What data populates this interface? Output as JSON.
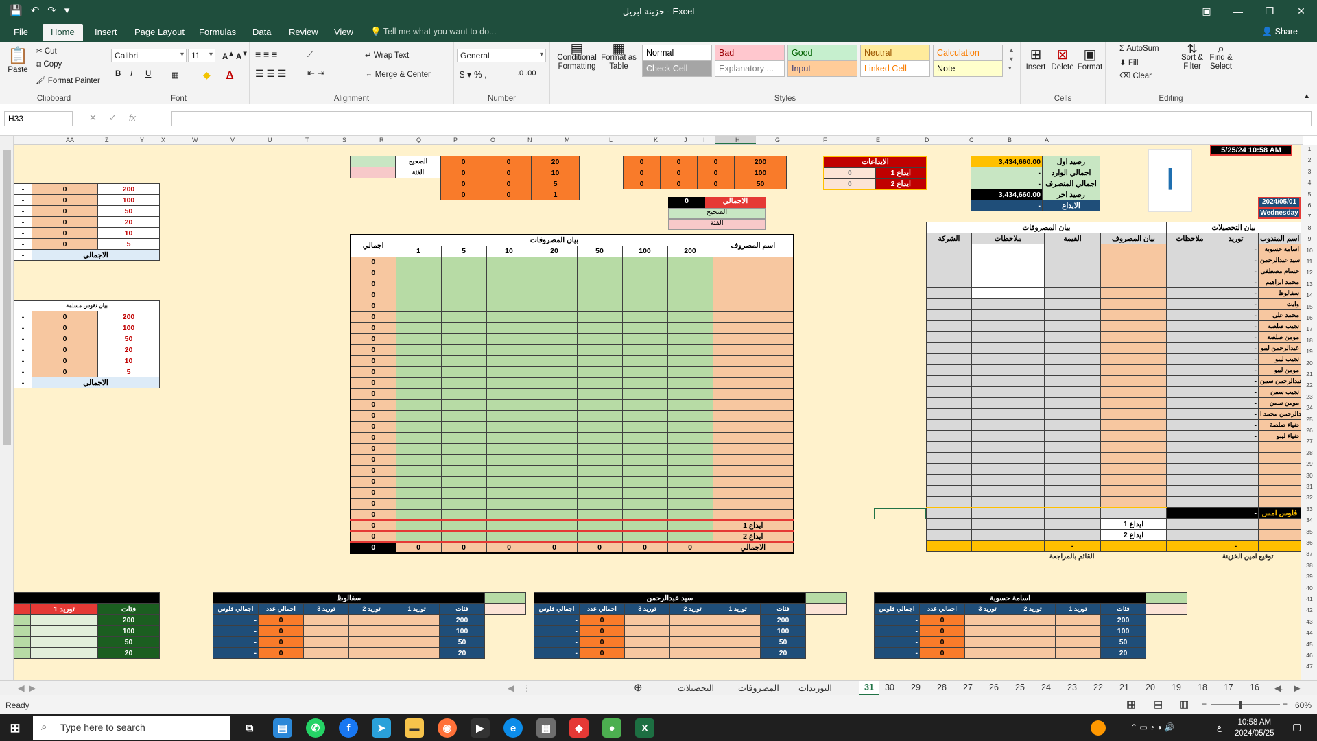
{
  "titlebar": {
    "title": "خزينة ابريل - Excel"
  },
  "tabs": [
    "File",
    "Home",
    "Insert",
    "Page Layout",
    "Formulas",
    "Data",
    "Review",
    "View"
  ],
  "tell": "Tell me what you want to do...",
  "share": "Share",
  "clipboard": {
    "paste": "Paste",
    "cut": "Cut",
    "copy": "Copy",
    "painter": "Format Painter",
    "label": "Clipboard"
  },
  "font": {
    "name": "Calibri",
    "size": "11",
    "label": "Font"
  },
  "alignment": {
    "wrap": "Wrap Text",
    "merge": "Merge & Center",
    "label": "Alignment"
  },
  "number": {
    "format": "General",
    "label": "Number"
  },
  "styles": {
    "cond": "Conditional Formatting",
    "table": "Format as Table",
    "label": "Styles",
    "cells": [
      {
        "t": "Normal",
        "bg": "#ffffff",
        "fg": "#000000"
      },
      {
        "t": "Bad",
        "bg": "#ffc7ce",
        "fg": "#9c0006"
      },
      {
        "t": "Good",
        "bg": "#c6efce",
        "fg": "#006100"
      },
      {
        "t": "Neutral",
        "bg": "#ffeb9c",
        "fg": "#9c5700"
      },
      {
        "t": "Calculation",
        "bg": "#f2f2f2",
        "fg": "#fa7d00"
      },
      {
        "t": "Check Cell",
        "bg": "#a5a5a5",
        "fg": "#ffffff"
      },
      {
        "t": "Explanatory ...",
        "bg": "#ffffff",
        "fg": "#7f7f7f"
      },
      {
        "t": "Input",
        "bg": "#ffcc99",
        "fg": "#3f3f76"
      },
      {
        "t": "Linked Cell",
        "bg": "#ffffff",
        "fg": "#fa7d00"
      },
      {
        "t": "Note",
        "bg": "#ffffcc",
        "fg": "#000000"
      }
    ]
  },
  "cells_grp": {
    "insert": "Insert",
    "delete": "Delete",
    "format": "Format",
    "label": "Cells"
  },
  "editing": {
    "autosum": "AutoSum",
    "fill": "Fill",
    "clear": "Clear",
    "sort": "Sort & Filter",
    "find": "Find & Select",
    "label": "Editing"
  },
  "namebox": "H33",
  "columns": [
    "AA",
    "Z",
    "Y",
    "X",
    "W",
    "V",
    "U",
    "T",
    "S",
    "R",
    "Q",
    "P",
    "O",
    "N",
    "M",
    "L",
    "K",
    "J",
    "I",
    "H",
    "G",
    "F",
    "E",
    "D",
    "C",
    "B",
    "A"
  ],
  "sheet": {
    "topdate": "5/25/24 10:58 AM",
    "date": "2024/05/01",
    "day": "Wednesday",
    "balance": [
      {
        "label": "رصيد اول",
        "value": "3,434,660.00"
      },
      {
        "label": "اجمالي الوارد",
        "value": "-"
      },
      {
        "label": "اجمالي المنصرف",
        "value": "-"
      },
      {
        "label": "رصيد اخر",
        "value": "3,434,660.00"
      },
      {
        "label": "الايداع",
        "value": "-"
      }
    ],
    "deposits": {
      "title": "الايداعات",
      "rows": [
        {
          "label": "ايداع 1",
          "value": "0"
        },
        {
          "label": "ايداع 2",
          "value": "0"
        }
      ]
    },
    "denoms": [
      "200",
      "100",
      "50",
      "20",
      "10",
      "5"
    ],
    "leftTable2Title": "بيان نقوس مسلمة",
    "total": "الاجمالي",
    "correct": "الصحيح",
    "category": "الفئة",
    "topMid": [
      [
        "20",
        "0",
        "0"
      ],
      [
        "10",
        "0",
        "0"
      ],
      [
        "5",
        "0",
        "0"
      ],
      [
        "1",
        "0",
        "0"
      ]
    ],
    "topRight": [
      [
        "200",
        "0",
        "0"
      ],
      [
        "100",
        "0",
        "0"
      ],
      [
        "50",
        "0",
        "0"
      ]
    ],
    "expenses": {
      "title": "بيان المصروفات",
      "nameCol": "اسم المصروف",
      "totalCol": "اجمالي",
      "denoms": [
        "200",
        "100",
        "50",
        "20",
        "10",
        "5",
        "1"
      ],
      "dep1": "ايداع 1",
      "dep2": "ايداع 2"
    },
    "collections": {
      "title": "بيان التحصيلات",
      "cols": [
        "اسم المندوب",
        "توريد",
        "ملاحظات"
      ]
    },
    "spendRight": {
      "title": "بيان المصروفات",
      "cols": [
        "بيان المصروف",
        "القيمة",
        "ملاحظات",
        "الشركة"
      ]
    },
    "reps": [
      "اسامة حسوبة",
      "سيد عبدالرحمن",
      "حسام مصطفي",
      "محمد ابراهيم",
      "سفالوظ",
      "وايت",
      "محمد علي",
      "نجيب صلصة",
      "مومن صلصة",
      "عبدالرحمن ليبو",
      "نجيب ليبو",
      "مومن ليبو",
      "عبدالرحمن سمن",
      "نجيب سمن",
      "مومن سمن",
      "عبدالرحمن محمد ا",
      "ضياء صلصة",
      "ضياء ليبو"
    ],
    "yesterday": "فلوس امس",
    "sign1": "توقيع امين الخزينة",
    "sign2": "القائم بالمراجعة",
    "bottomGroups": [
      "اسامة حسوبة",
      "سيد عبدالرحمن",
      "سفالوظ"
    ],
    "bottomCols": [
      "فئات",
      "توريد 1",
      "توريد 2",
      "توريد 3",
      "اجمالي عدد",
      "اجمالي فلوس"
    ],
    "bottomLeft": "توريد 1"
  },
  "sheetTabs": [
    "التحصيلات",
    "المصروفات",
    "التوريدات",
    "31",
    "30",
    "29",
    "28",
    "27",
    "26",
    "25",
    "24",
    "23",
    "22",
    "21",
    "20",
    "19",
    "18",
    "17",
    "16",
    "..."
  ],
  "activeTab": "31",
  "status": {
    "ready": "Ready",
    "zoom": "60%"
  },
  "taskbar": {
    "search": "Type here to search",
    "time": "10:58 AM",
    "date": "2024/05/25",
    "lang": "ع"
  }
}
